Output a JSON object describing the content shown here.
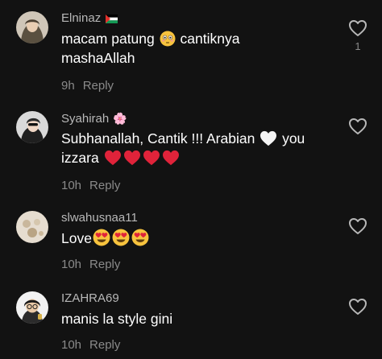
{
  "comments": [
    {
      "username": "Elninaz",
      "username_suffix": "",
      "text_line1": "macam patung",
      "text_line1_after": "cantiknya",
      "text_line2": "mashaAllah",
      "time": "9h",
      "reply": "Reply",
      "like_count": "1",
      "flag_icon": "palestine-flag-icon",
      "emoji_icon": "flushed-face-emoji"
    },
    {
      "username": "Syahirah",
      "username_suffix": "🌸",
      "text_line1": "Subhanallah, Cantik !!! Arabian",
      "text_line1_after": "you",
      "text_line2": "izzara",
      "time": "10h",
      "reply": "Reply",
      "like_count": "",
      "emoji_icon": "white-heart-emoji"
    },
    {
      "username": "slwahusnaa11",
      "username_suffix": "",
      "text_line1": "Love",
      "time": "10h",
      "reply": "Reply",
      "like_count": "",
      "emoji_icon": "heart-eyes-emoji"
    },
    {
      "username": "IZAHRA69",
      "username_suffix": "",
      "text_line1": "manis la style gini",
      "time": "10h",
      "reply": "Reply",
      "like_count": ""
    }
  ],
  "colors": {
    "background": "#121212",
    "username": "#b8b8b8",
    "meta": "#8a8a8a",
    "text": "#ffffff",
    "heart_red": "#e0233a"
  }
}
